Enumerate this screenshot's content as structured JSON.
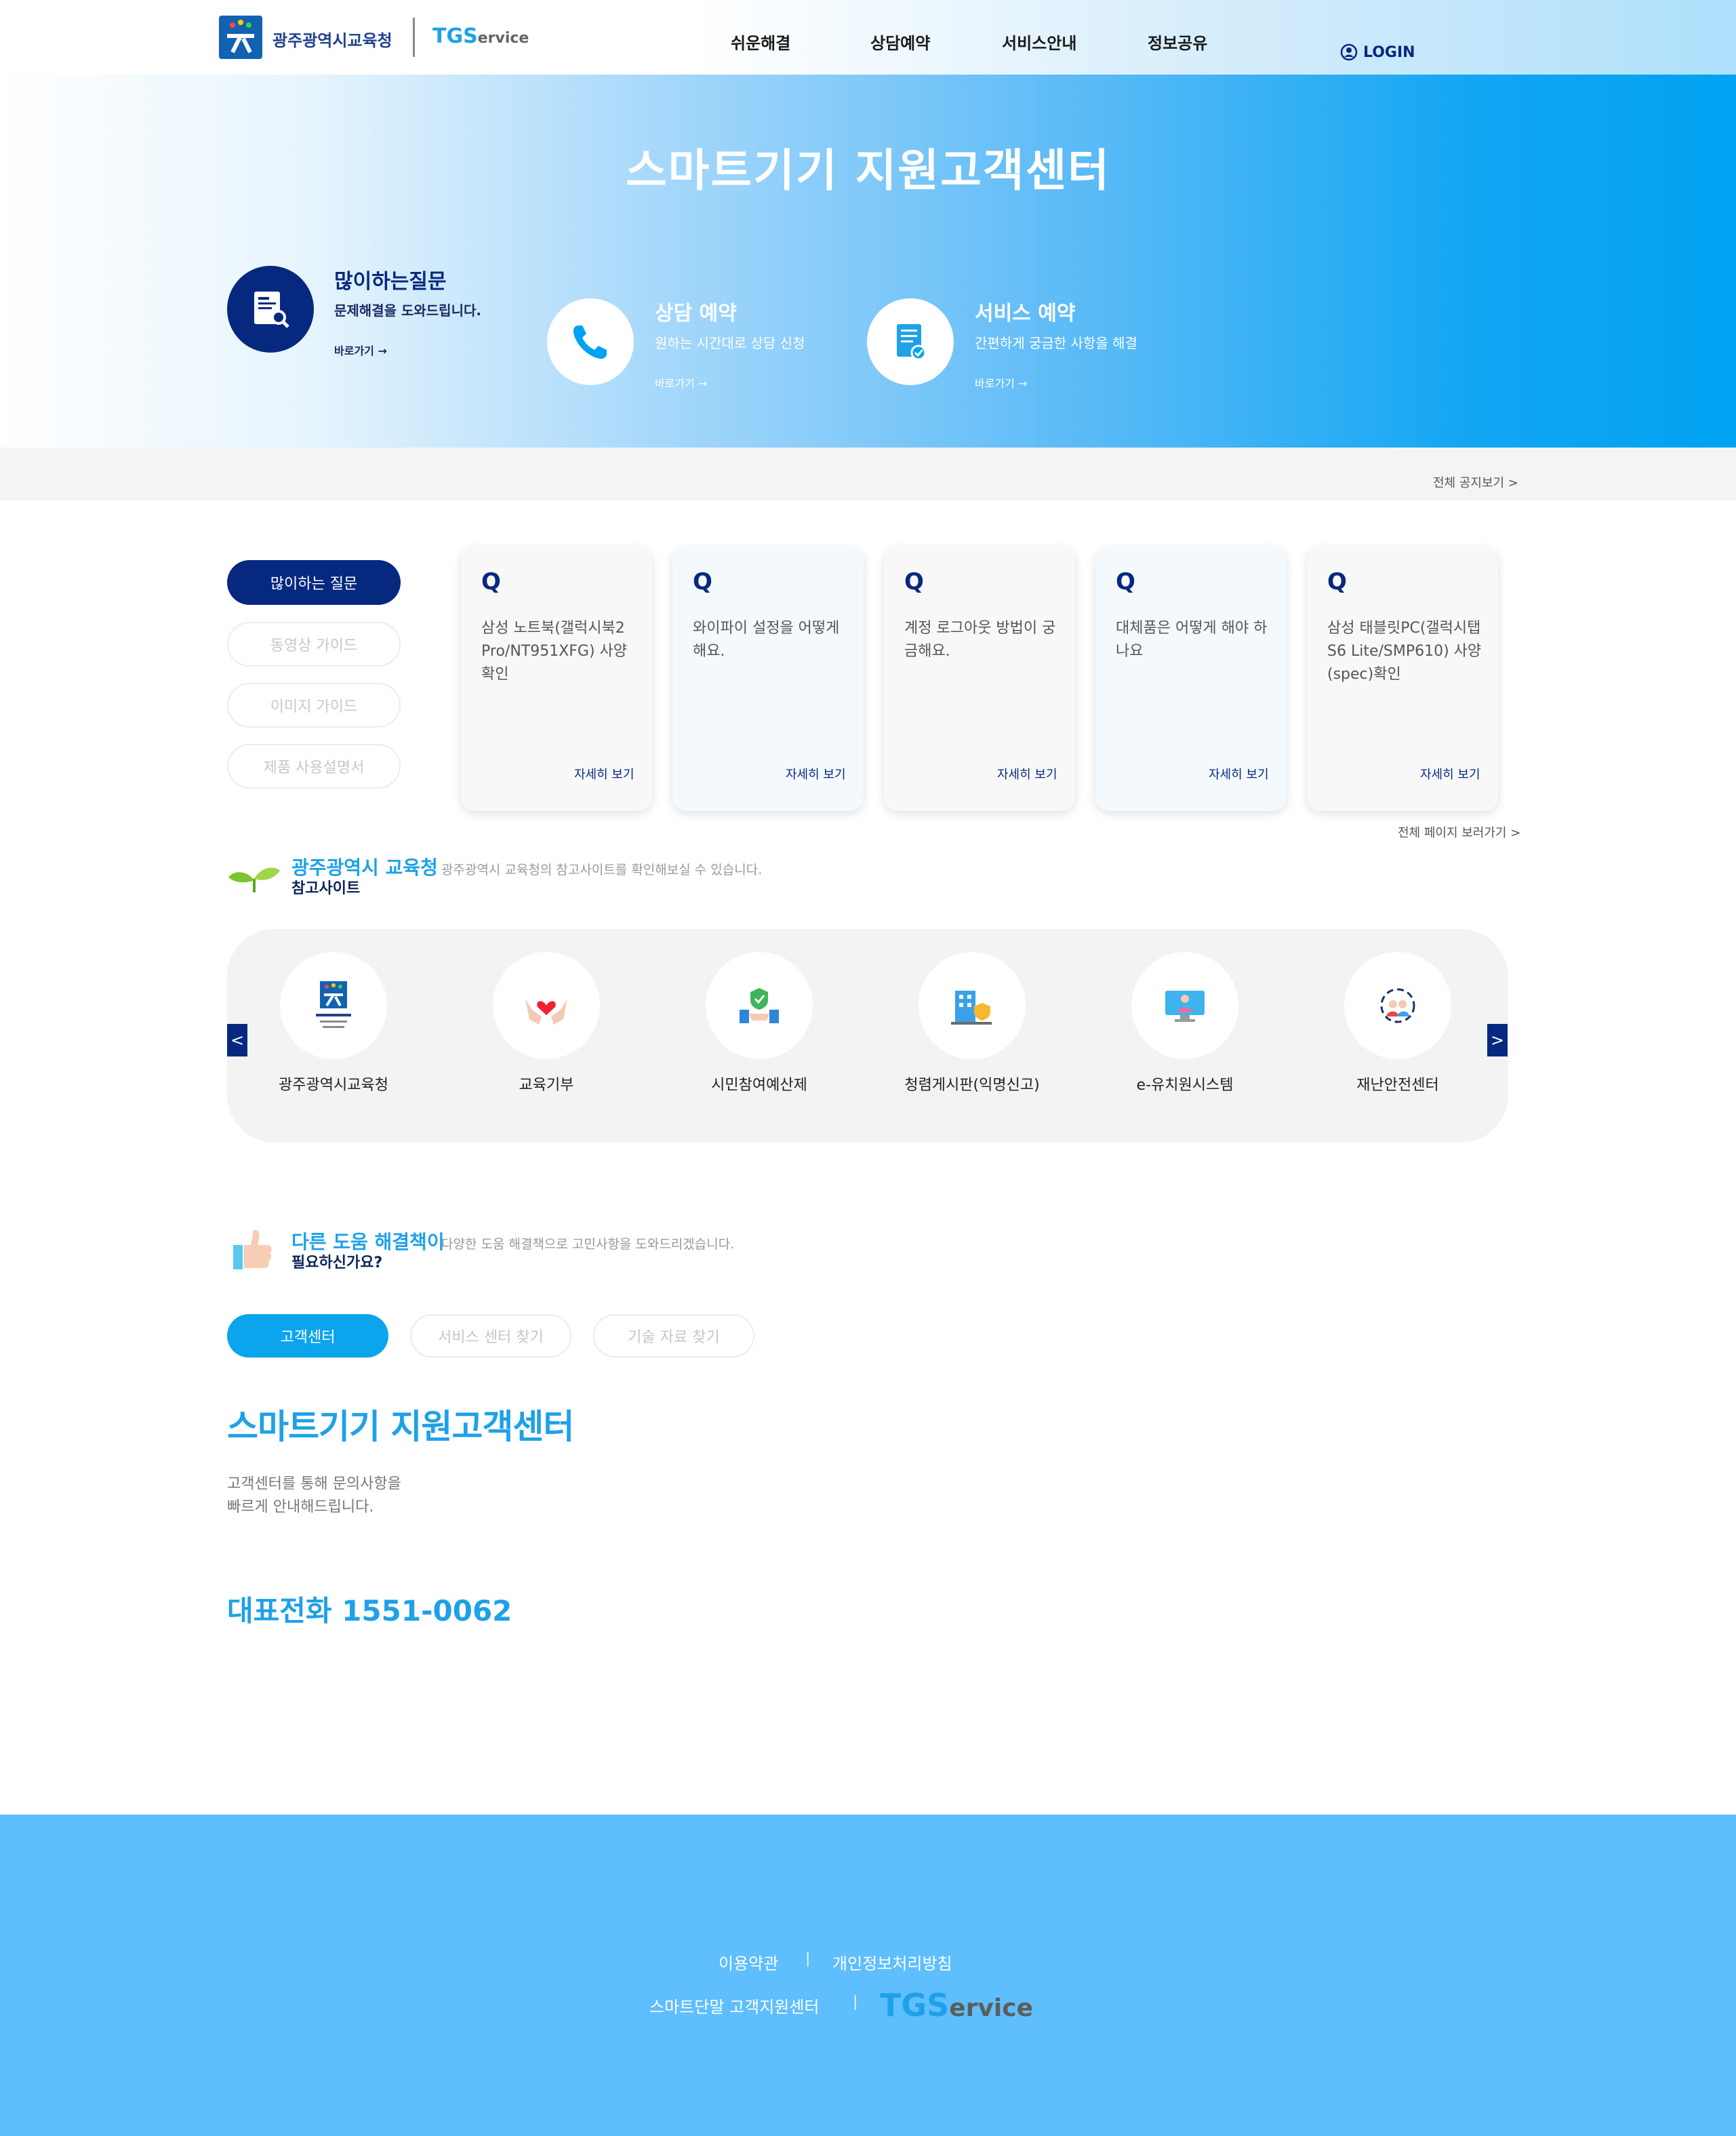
{
  "header": {
    "org_name": "광주광역시교육청",
    "tgs_big": "TGS",
    "tgs_small": "ervice",
    "nav": [
      "쉬운해결",
      "상담예약",
      "서비스안내",
      "정보공유"
    ],
    "login": "LOGIN"
  },
  "hero": {
    "title": "스마트기기 지원고객센터",
    "cards": [
      {
        "title": "많이하는질문",
        "sub": "문제해결을 도와드립니다.",
        "link": "바로가기 →"
      },
      {
        "title": "상담 예약",
        "sub": "원하는 시간대로 상담 신청",
        "link": "바로가기 →"
      },
      {
        "title": "서비스 예약",
        "sub": "간편하게 궁금한 사항을 해결",
        "link": "바로가기 →"
      }
    ]
  },
  "notice": {
    "all_link": "전체 공지보기 >"
  },
  "faq": {
    "tabs": [
      "많이하는 질문",
      "동영상 가이드",
      "이미지 가이드",
      "제품 사용설명서"
    ],
    "q_label": "Q",
    "more_label": "자세히 보기",
    "items": [
      "삼성 노트북(갤럭시북2 Pro/NT951XFG) 사양 확인",
      "와이파이 설정을 어떻게 해요.",
      "계정 로그아웃 방법이 궁금해요.",
      "대체품은 어떻게 해야 하나요",
      "삼성 태블릿PC(갤럭시탭 S6 Lite/SMP610) 사양(spec)확인"
    ],
    "all_link": "전체 페이지 보러가기 >"
  },
  "sites": {
    "title1": "광주광역시 교육청",
    "title2": "참고사이트",
    "desc": "광주광역시 교육청의 참고사이트를 확인해보실 수 있습니다.",
    "prev": "<",
    "next": ">",
    "items": [
      "광주광역시교육청",
      "교육기부",
      "시민참여예산제",
      "청렴게시판(익명신고)",
      "e-유치원시스템",
      "재난안전센터"
    ]
  },
  "help": {
    "title1": "다른 도움 해결책이",
    "title2": "필요하신가요?",
    "desc": "다양한 도움 해결책으로 고민사항을 도와드리겠습니다.",
    "tabs": [
      "고객센터",
      "서비스 센터 찾기",
      "기술 자료 찾기"
    ],
    "center_title": "스마트기기 지원고객센터",
    "center_desc1": "고객센터를 통해 문의사항을",
    "center_desc2": "빠르게 안내해드립니다.",
    "phone": "대표전화 1551-0062"
  },
  "footer": {
    "terms": "이용약관",
    "privacy": "개인정보처리방침",
    "sep": "|",
    "center": "스마트단말 고객지원센터",
    "tgs_big": "TGS",
    "tgs_small": "ervice"
  }
}
